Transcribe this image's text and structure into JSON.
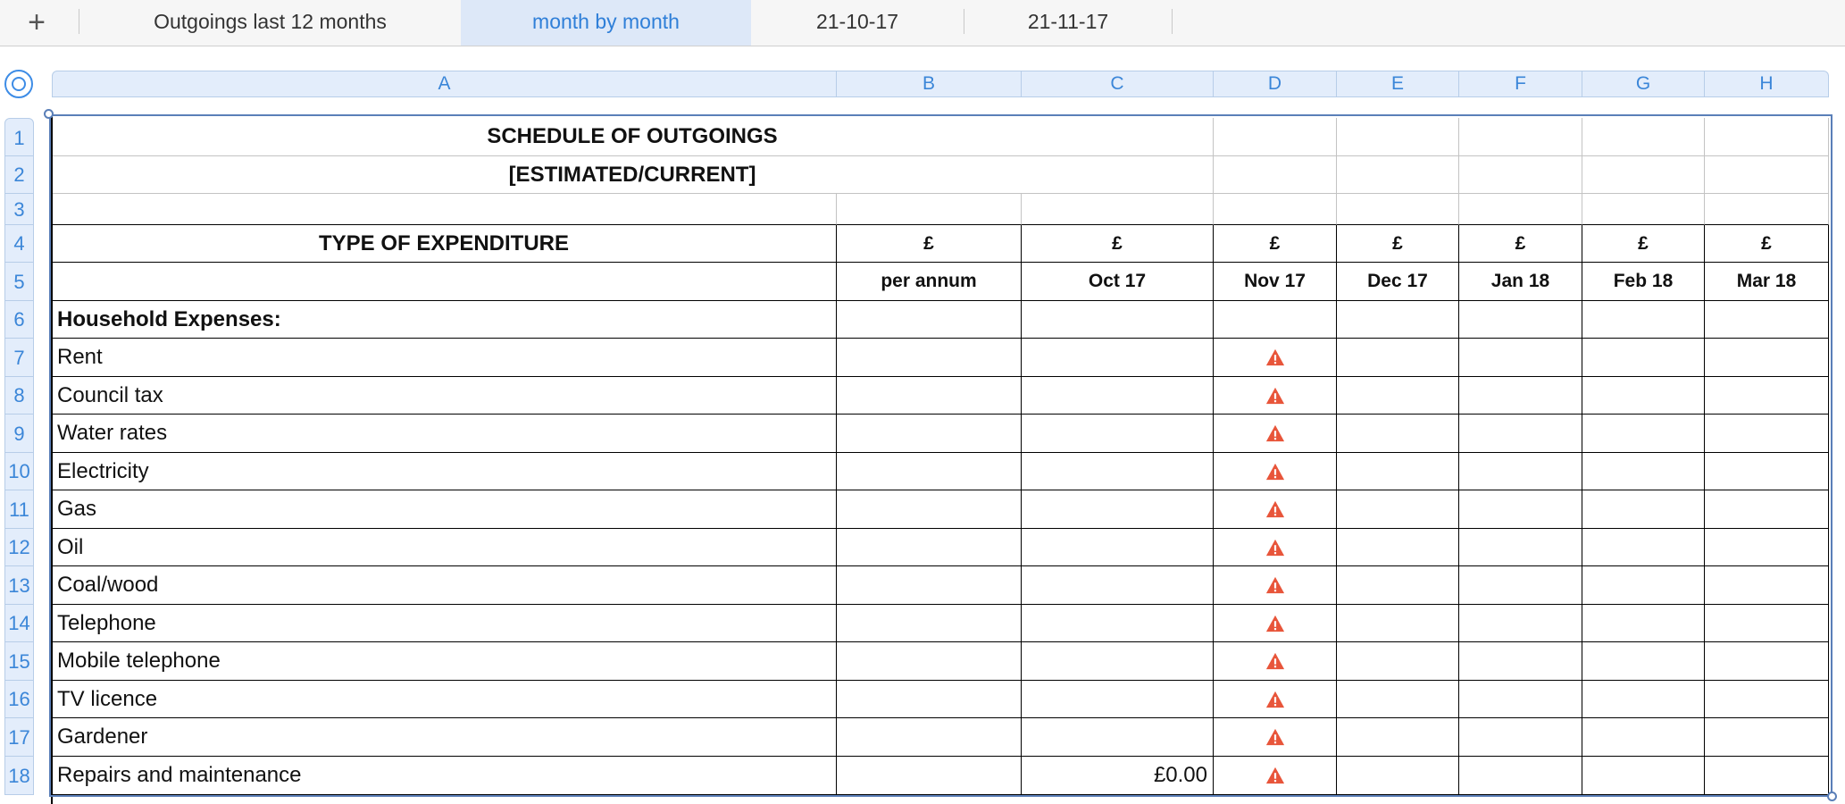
{
  "tabs": [
    {
      "label": "Outgoings last 12 months",
      "active": false
    },
    {
      "label": "month by month",
      "active": true
    },
    {
      "label": "21-10-17",
      "active": false
    },
    {
      "label": "21-11-17",
      "active": false
    }
  ],
  "add_tab_label": "+",
  "columns": [
    "A",
    "B",
    "C",
    "D",
    "E",
    "F",
    "G",
    "H"
  ],
  "rows": [
    "1",
    "2",
    "3",
    "4",
    "5",
    "6",
    "7",
    "8",
    "9",
    "10",
    "11",
    "12",
    "13",
    "14",
    "15",
    "16",
    "17",
    "18"
  ],
  "sheet": {
    "title": "SCHEDULE OF OUTGOINGS",
    "subtitle": "[ESTIMATED/CURRENT]",
    "type_header": "TYPE OF EXPENDITURE",
    "currency_symbol": "£",
    "period_headers": [
      "per annum",
      "Oct 17",
      "Nov 17",
      "Dec 17",
      "Jan 18",
      "Feb 18",
      "Mar 18"
    ],
    "section_title": "Household Expenses:",
    "items": [
      {
        "name": "Rent",
        "oct": "",
        "warning": true
      },
      {
        "name": "Council tax",
        "oct": "",
        "warning": true
      },
      {
        "name": "Water rates",
        "oct": "",
        "warning": true
      },
      {
        "name": "Electricity",
        "oct": "",
        "warning": true
      },
      {
        "name": "Gas",
        "oct": "",
        "warning": true
      },
      {
        "name": "Oil",
        "oct": "",
        "warning": true
      },
      {
        "name": "Coal/wood",
        "oct": "",
        "warning": true
      },
      {
        "name": "Telephone",
        "oct": "",
        "warning": true
      },
      {
        "name": "Mobile telephone",
        "oct": "",
        "warning": true
      },
      {
        "name": "TV licence",
        "oct": "",
        "warning": true
      },
      {
        "name": "Gardener",
        "oct": "",
        "warning": true
      },
      {
        "name": "Repairs and maintenance",
        "oct": "£0.00",
        "warning": true
      }
    ]
  },
  "icons": {
    "warning": "warning-triangle-icon",
    "select_all": "select-all-circle-icon"
  },
  "colors": {
    "accent": "#3b86d8",
    "header_bg": "#e3edfb",
    "active_tab_bg": "#dde8f8",
    "warning": "#e8553a",
    "selection": "#5a7fb8"
  }
}
